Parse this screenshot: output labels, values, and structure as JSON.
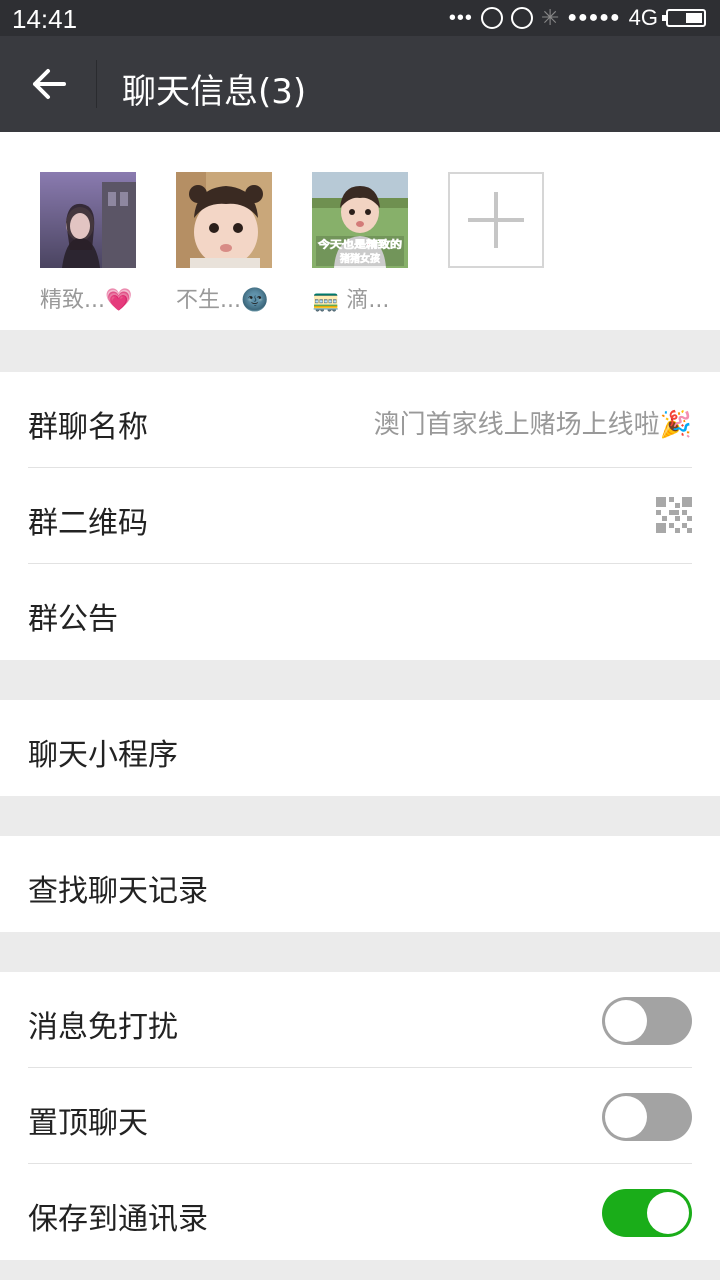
{
  "status_bar": {
    "time": "14:41",
    "dots": "•••",
    "network": "4G",
    "signal": "●●●●●"
  },
  "header": {
    "title": "聊天信息(3)"
  },
  "members": [
    {
      "name": "精致...💗"
    },
    {
      "name": "不生...🌚"
    },
    {
      "name": "🚃 滴...",
      "avatar_caption": "今天也是精致的猪猪女孩"
    }
  ],
  "settings": {
    "group_name": {
      "label": "群聊名称",
      "value": "澳门首家线上赌场上线啦🎉"
    },
    "qr_code": {
      "label": "群二维码"
    },
    "announcement": {
      "label": "群公告"
    },
    "mini_program": {
      "label": "聊天小程序"
    },
    "search_history": {
      "label": "查找聊天记录"
    },
    "mute": {
      "label": "消息免打扰",
      "on": false
    },
    "pin": {
      "label": "置顶聊天",
      "on": false
    },
    "save_contacts": {
      "label": "保存到通讯录",
      "on": true
    }
  },
  "colors": {
    "topbar": "#393a3f",
    "switch_on": "#1aad19",
    "switch_off": "#a3a3a3"
  }
}
